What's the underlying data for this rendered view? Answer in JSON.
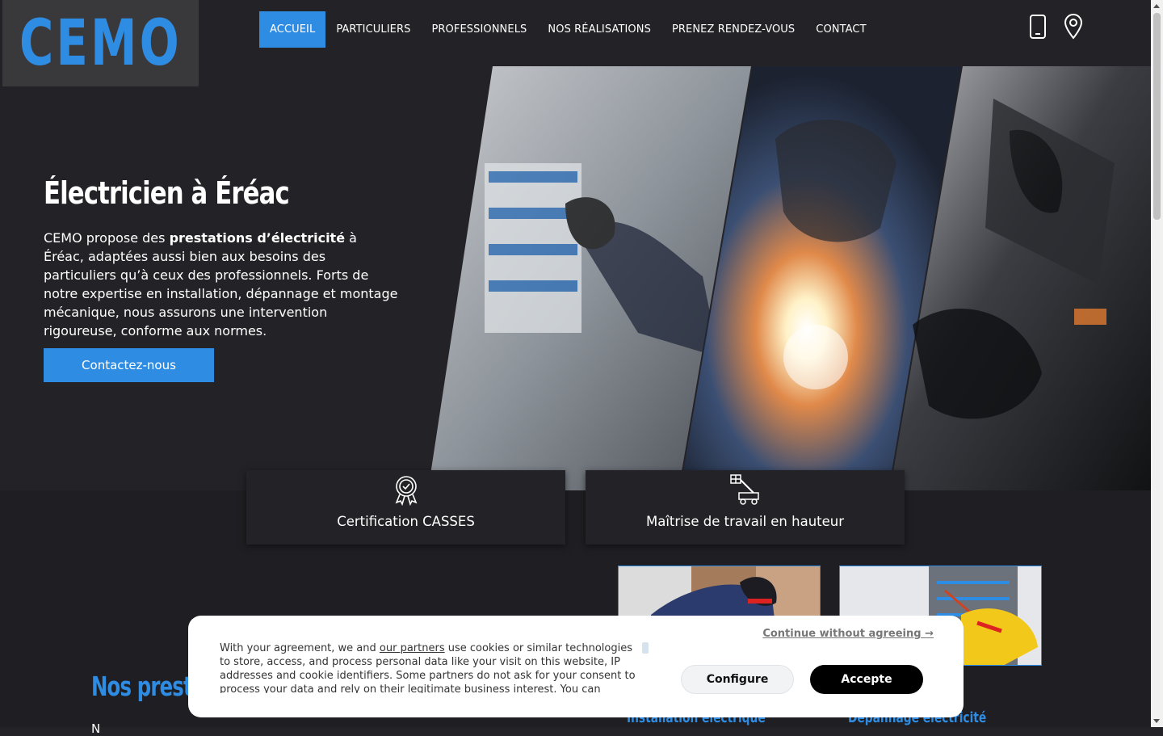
{
  "brand": {
    "logo_text": "CEMO",
    "accent": "#2f8ce3"
  },
  "nav": {
    "items": [
      "ACCUEIL",
      "PARTICULIERS",
      "PROFESSIONNELS",
      "NOS RÉALISATIONS",
      "PRENEZ RENDEZ-VOUS",
      "CONTACT"
    ],
    "active": "ACCUEIL"
  },
  "header_icons": [
    "phone-icon",
    "location-pin-icon"
  ],
  "hero": {
    "title": "Électricien à Éréac",
    "text_before": "CEMO propose des ",
    "text_bold": "prestations d’électricité",
    "text_after": " à Éréac, adaptées aussi bien aux besoins des particuliers qu’à ceux des professionnels. Forts de notre expertise en installation, dépannage et montage mécanique, nous assurons une intervention rigoureuse, conforme aux normes.",
    "cta": "Contactez-nous"
  },
  "features": [
    {
      "label": "Certification CASSES",
      "icon": "award-badge-icon"
    },
    {
      "label": "Maîtrise de travail en hauteur",
      "icon": "aerial-lift-icon"
    }
  ],
  "services": {
    "title": "Nos presta",
    "text": "N",
    "items": [
      "Installation électrique",
      "Dépannage électricité"
    ]
  },
  "cookie": {
    "text_before": "With your agreement, we and ",
    "link": "our partners",
    "text_after": " use cookies or similar technologies to store, access, and process personal data like your visit on this website, IP addresses and cookie identifiers. Some partners do not ask for your consent to process your data and rely on their legitimate business interest. You can",
    "continue": "Continue without agreeing →",
    "configure": "Configure",
    "accept": "Accepte"
  }
}
